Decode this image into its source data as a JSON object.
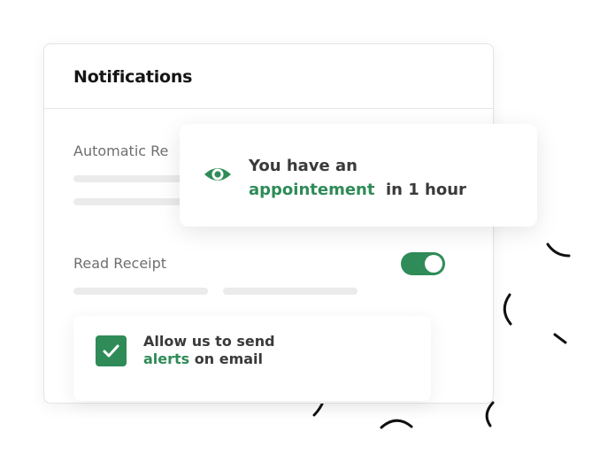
{
  "card": {
    "title": "Notifications",
    "automatic_label": "Automatic Re",
    "read_receipt_label": "Read Receipt",
    "read_receipt_enabled": true
  },
  "popup": {
    "icon": "eye-icon",
    "line1": "You have an",
    "highlight": "appointement",
    "suffix": "in 1 hour"
  },
  "consent": {
    "checked": true,
    "icon": "check-icon",
    "line1": "Allow us to send",
    "highlight": "alerts",
    "suffix": "on email"
  },
  "colors": {
    "accent": "#2f8b57",
    "placeholder": "#ebebeb"
  }
}
